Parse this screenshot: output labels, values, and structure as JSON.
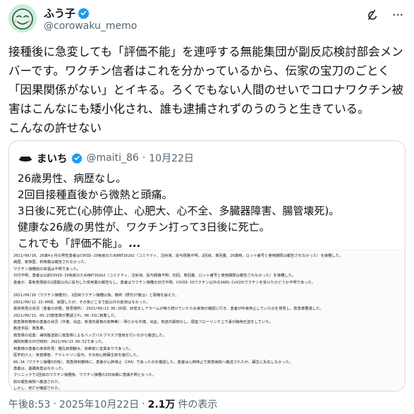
{
  "author": {
    "display_name": "ふう子",
    "handle": "@corowaku_memo"
  },
  "tweet": {
    "text": "接種後に急変しても「評価不能」を連呼する無能集団が副反応検討部会メンバーです。ワクチン信者はこれを分かっているから、伝家の宝刀のごとく「因果関係がない」とイキる。ろくでもない人間のせいでコロナワクチン被害はこんなにも矮小化され、誰も逮捕されずのうのうと生きている。\nこんなの許せない"
  },
  "quote": {
    "display_name": "まいち",
    "handle": "@maiti_86",
    "separator": "·",
    "date": "10月22日",
    "text": "26歳男性、病歴なし。\n2回目接種直後から微熱と頭痛。\n3日後に死亡(心肺停止、心肥大、心不全、多臓器障害、腸管壊死)。\n健康な26歳の男性が、ワクチン打って3日後に死亡。\nこれでも「評価不能」。",
    "ellipsis": "...",
    "image_lines": [
      "2021/09/10、26歳4ヵ月の男性患者はCOVID-19免疫のためBNT162b2（コミナティ、注射液、投与経路不明、2回目、単回量、26歳時、ロット番号と使用期限は報告されなかった）を接種した。",
      "病歴、家族歴、併用薬は報告されなかった。",
      "ワクチン接種前の体温は不明であった。",
      "日付不明、患者は以前COVID-19免疫のためBNT162b2（コミナティ、注射液、投与経路不明、初回、単回量、ロット番号と使用期限は報告されなかった）を接種した。",
      "患者が、事象発現前の2週間以内に投与した併用薬の報告なし。患者はワクチン接種の日付不明、COVID-19ワクチン以外のSARS-CoV2のワクチンを受けたかどうか不明であった。",
      "",
      "2021/09/10（ワクチン接種日）、2回目ワクチン接種以後、微熱（摂氏37度台）と頭痛を訴えた。",
      "2021/09/12 23:00頃、就寝したが、その後どこまで起以外の症状はなかった。",
      "異常発見の状況（患者の状態、発見場所）：2021/09/13 06:20頃、目覚ましアラームが鳴り続けていたため家族が確認に行き、患者が呼吸停止していたのを発見し、救急車要請した。",
      "2021/09/13、06:23救急隊が要請され、06:33に到着した。",
      "救急隊到着時の患者の状況（外傷、出血、気道内異物の有無等）：明らかな外傷、出血、気道内異物なし、寝室フローリング上で妻が胸骨圧迫をしていた。",
      "搬送手段：救急車。",
      "救急隊の処置：病院搬送前に救急隊によるバッグバルブマスク換気を行いながら搬送した。",
      "病院到着の日付時刻：2021/09/13 06:52であった。",
      "到着時の患者の身体所見：瞳孔両側散大、体幹前に変異ありであった。",
      "医学的介入：気管挿管、アドレナリン投与、その他心肺蘇生術を施行した。",
      "06:34（ワクチン接種3日後）、救急隊到着時に、患者が心肺停止（CPA）であったのを確認した。患者は心肺停止で救急病院へ搬送されたが、蘇生に反応しなかった。",
      "患者は、基礎疾患はなかった。",
      "クリニックで2回目のワクチン接種後、ワクチン接種の3日目朝に意識不明となった。",
      "前の報告病院へ搬送された。",
      "しかし、死亡が確認された。",
      "2021/09/13 08:08、死亡が確認された。",
      "ＣＴでは実施不明であった。調査結果を踏まえ、心肺停止（CPA）の原因であるかどうか、判断することができなかった。",
      "患者には、多臓器障害があった。"
    ]
  },
  "meta": {
    "time": "午後8:53",
    "dot1": "·",
    "date": "2025年10月22日",
    "dot2": "·",
    "views_count": "2.1万",
    "views_label": "件の表示"
  }
}
